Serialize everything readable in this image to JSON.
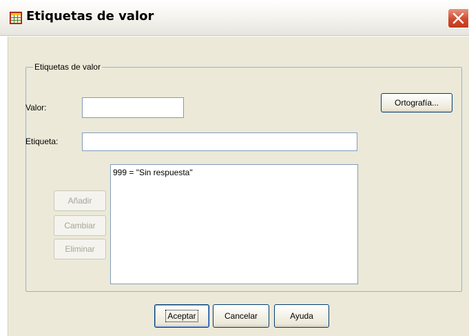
{
  "window": {
    "title": "Etiquetas de valor",
    "app_icon": "table-grid-icon",
    "close_icon": "close-icon"
  },
  "group": {
    "legend": "Etiquetas de valor"
  },
  "fields": {
    "valor_label": "Valor:",
    "valor_value": "",
    "etiqueta_label": "Etiqueta:",
    "etiqueta_value": ""
  },
  "buttons": {
    "spelling": "Ortografía...",
    "add": "Añadir",
    "change": "Cambiar",
    "remove": "Eliminar",
    "ok": "Aceptar",
    "cancel": "Cancelar",
    "help": "Ayuda"
  },
  "value_labels": [
    "999 = \"Sin respuesta\""
  ],
  "colors": {
    "close_button": "#cf4a2c",
    "dialog_background": "#ece9d8",
    "group_border": "#8fb4d6"
  }
}
